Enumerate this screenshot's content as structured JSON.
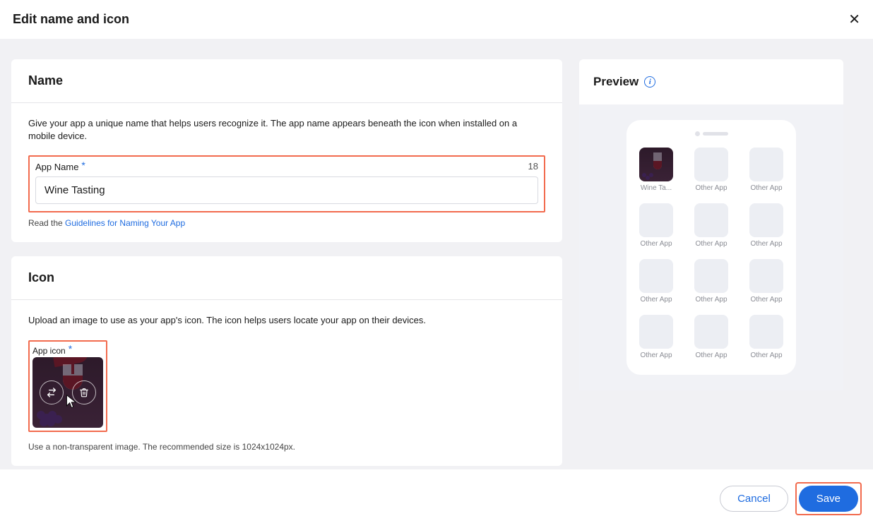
{
  "header": {
    "title": "Edit name and icon"
  },
  "nameCard": {
    "heading": "Name",
    "description": "Give your app a unique name that helps users recognize it. The app name appears beneath the icon when installed on a mobile device.",
    "fieldLabel": "App Name",
    "charCount": "18",
    "value": "Wine Tasting",
    "helperPrefix": "Read the ",
    "helperLink": "Guidelines for Naming Your App"
  },
  "iconCard": {
    "heading": "Icon",
    "description": "Upload an image to use as your app's icon. The icon helps users locate your app on their devices.",
    "fieldLabel": "App icon",
    "helper": "Use a non-transparent image. The recommended size is 1024x1024px."
  },
  "preview": {
    "heading": "Preview",
    "apps": [
      "Wine Ta...",
      "Other App",
      "Other App",
      "Other App",
      "Other App",
      "Other App",
      "Other App",
      "Other App",
      "Other App",
      "Other App",
      "Other App",
      "Other App"
    ]
  },
  "footer": {
    "cancel": "Cancel",
    "save": "Save"
  }
}
